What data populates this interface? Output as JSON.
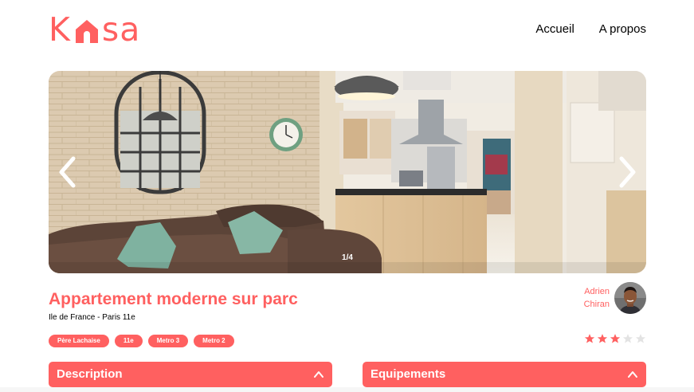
{
  "brand": {
    "letter_k": "K",
    "letters_sa": "sa",
    "accent": "#FF6060"
  },
  "nav": {
    "home": "Accueil",
    "about": "A propos"
  },
  "carousel": {
    "counter": "1/4",
    "prev_icon": "chevron-left-icon",
    "next_icon": "chevron-right-icon"
  },
  "listing": {
    "title": "Appartement moderne sur parc",
    "location": "Ile de France - Paris 11e",
    "tags": [
      "Père Lachaise",
      "11e",
      "Metro 3",
      "Metro 2"
    ]
  },
  "host": {
    "first_name": "Adrien",
    "last_name": "Chiran"
  },
  "rating": {
    "value": 3,
    "max": 5,
    "filled_color": "#FF6060",
    "empty_color": "#E3E3E3"
  },
  "sections": {
    "description": "Description",
    "equipments": "Equipements"
  }
}
